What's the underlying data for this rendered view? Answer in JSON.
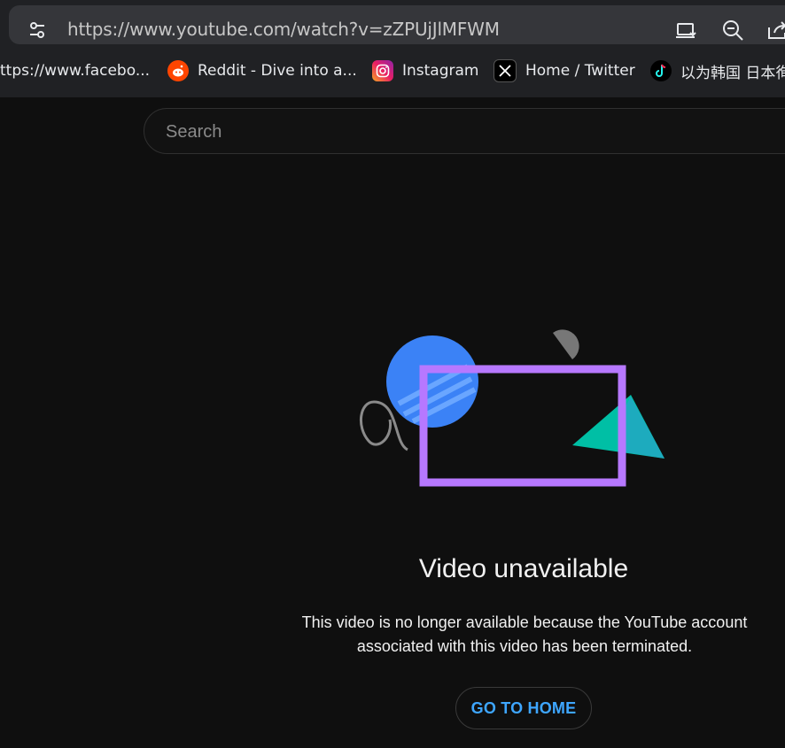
{
  "browser": {
    "url": "https://www.youtube.com/watch?v=zZPUjJlMFWM",
    "bookmarks": [
      {
        "label": "ttps://www.facebo...",
        "icon": "facebook-icon"
      },
      {
        "label": "Reddit - Dive into a...",
        "icon": "reddit-icon"
      },
      {
        "label": "Instagram",
        "icon": "instagram-icon"
      },
      {
        "label": "Home / Twitter",
        "icon": "x-icon"
      },
      {
        "label": "以为韩国 日本徇",
        "icon": "tiktok-icon"
      }
    ]
  },
  "page": {
    "search_placeholder": "Search",
    "title": "Video unavailable",
    "message_line1": "This video is no longer available because the YouTube account",
    "message_line2": "associated with this video has been terminated.",
    "home_button": "GO TO HOME"
  },
  "colors": {
    "accent": "#3ea6ff",
    "background": "#0f0f0f"
  }
}
